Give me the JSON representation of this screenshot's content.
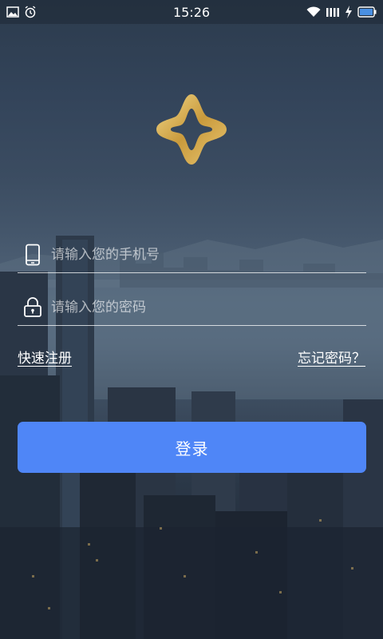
{
  "status_bar": {
    "time": "15:26",
    "icons_left": [
      "image-icon",
      "alarm-icon"
    ],
    "icons_right": [
      "wifi-icon",
      "signal-icon",
      "charging-icon",
      "battery-icon"
    ]
  },
  "login": {
    "phone_placeholder": "请输入您的手机号",
    "password_placeholder": "请输入您的密码",
    "register_link": "快速注册",
    "forgot_link": "忘记密码？",
    "login_button": "登录"
  },
  "colors": {
    "accent": "#4f86f7",
    "logo_gold": "#d9b55a"
  }
}
